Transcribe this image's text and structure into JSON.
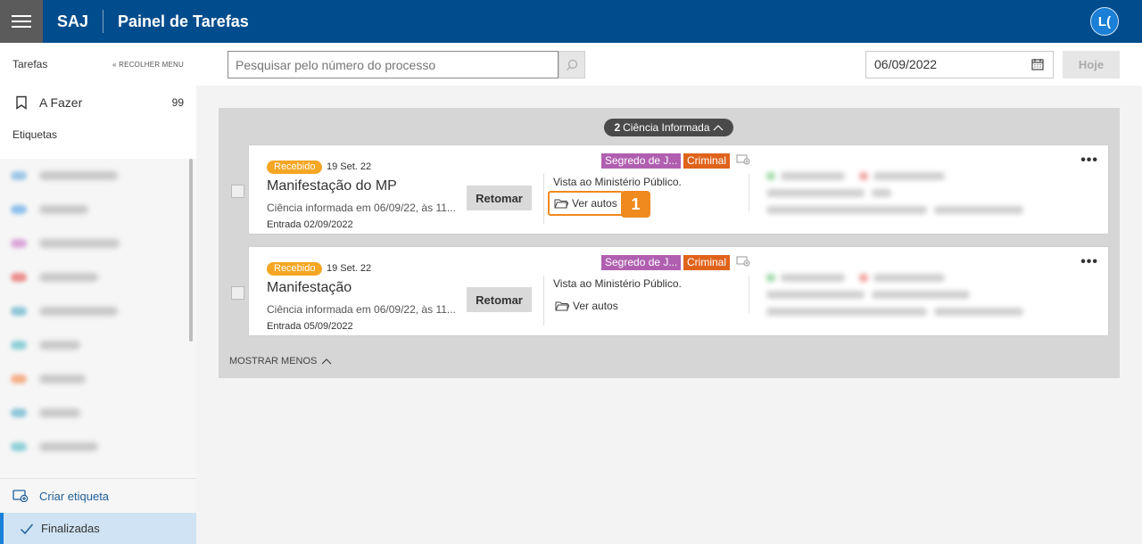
{
  "header": {
    "brand": "SAJ",
    "title": "Painel de Tarefas",
    "avatar": "L("
  },
  "sidebar": {
    "section_title": "Tarefas",
    "collapse_label": "RECOLHER MENU",
    "todo_label": "A Fazer",
    "todo_count": "99",
    "tags_title": "Etiquetas",
    "tag_colors": [
      "#9ec7e6",
      "#8fc0ec",
      "#d9a7d9",
      "#ea8e8e",
      "#8fc6d8",
      "#8fd0d8",
      "#f4b08a",
      "#8fc6d8",
      "#8fd0d8"
    ],
    "create_tag_label": "Criar etiqueta",
    "finished_label": "Finalizadas"
  },
  "toolbar": {
    "search_placeholder": "Pesquisar pelo número do processo",
    "date_value": "06/09/2022",
    "today_label": "Hoje"
  },
  "group": {
    "count": "2",
    "label": "Ciência Informada",
    "show_less": "MOSTRAR MENOS"
  },
  "cards": [
    {
      "badge": "Recebido",
      "date": "19 Set. 22",
      "title": "Manifestação do MP",
      "subtitle": "Ciência informada em 06/09/22, às 11...",
      "entry": "Entrada 02/09/2022",
      "resume_label": "Retomar",
      "tag_secret": "Segredo de J...",
      "tag_criminal": "Criminal",
      "action": "Vista ao Ministério Público.",
      "view_label": "Ver autos",
      "step": "1"
    },
    {
      "badge": "Recebido",
      "date": "19 Set. 22",
      "title": "Manifestação",
      "subtitle": "Ciência informada em 06/09/22, às 11...",
      "entry": "Entrada 05/09/2022",
      "resume_label": "Retomar",
      "tag_secret": "Segredo de J...",
      "tag_criminal": "Criminal",
      "action": "Vista ao Ministério Público.",
      "view_label": "Ver autos"
    }
  ]
}
